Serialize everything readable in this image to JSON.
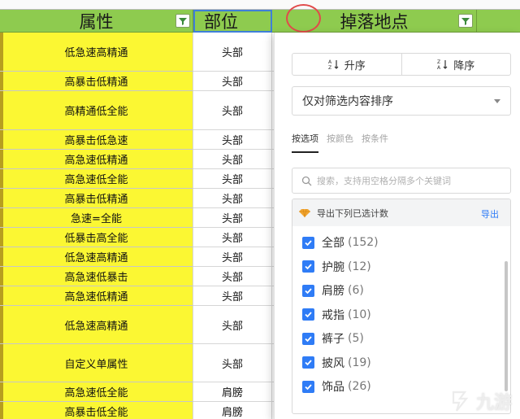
{
  "sheet": {
    "headers": {
      "attribute": "属性",
      "position": "部位",
      "drop_location": "掉落地点"
    },
    "rows": [
      {
        "attribute": "低急速高精通",
        "position": "头部"
      },
      {
        "attribute": "高暴击低精通",
        "position": "头部"
      },
      {
        "attribute": "高精通低全能",
        "position": "头部"
      },
      {
        "attribute": "高暴击低急速",
        "position": "头部"
      },
      {
        "attribute": "高急速低精通",
        "position": "头部"
      },
      {
        "attribute": "高急速低全能",
        "position": "头部"
      },
      {
        "attribute": "高暴击低精通",
        "position": "头部"
      },
      {
        "attribute": "急速=全能",
        "position": "头部"
      },
      {
        "attribute": "低暴击高全能",
        "position": "头部"
      },
      {
        "attribute": "低急速高精通",
        "position": "头部"
      },
      {
        "attribute": "高急速低暴击",
        "position": "头部"
      },
      {
        "attribute": "高急速低精通",
        "position": "头部"
      },
      {
        "attribute": "低急速高精通",
        "position": "头部"
      },
      {
        "attribute": "自定义单属性",
        "position": "头部"
      },
      {
        "attribute": "高急速低全能",
        "position": "肩膀"
      },
      {
        "attribute": "高暴击低全能",
        "position": "肩膀"
      }
    ]
  },
  "filter_panel": {
    "sort_asc": "升序",
    "sort_desc": "降序",
    "sort_scope": "仅对筛选内容排序",
    "tabs": [
      "按选项",
      "按颜色",
      "按条件"
    ],
    "search_placeholder": "搜索，支持用空格分隔多个关键词",
    "export_label": "导出下列已选计数",
    "export_link": "导出",
    "options": [
      {
        "label": "全部",
        "count": "(152)",
        "checked": true
      },
      {
        "label": "护腕",
        "count": "(12)",
        "checked": true
      },
      {
        "label": "肩膀",
        "count": "(6)",
        "checked": true
      },
      {
        "label": "戒指",
        "count": "(10)",
        "checked": true
      },
      {
        "label": "裤子",
        "count": "(5)",
        "checked": true
      },
      {
        "label": "披风",
        "count": "(19)",
        "checked": true
      },
      {
        "label": "饰品",
        "count": "(26)",
        "checked": true
      }
    ]
  },
  "colors": {
    "header_green": "#8ecb4f",
    "attribute_yellow": "#fbf733",
    "accent_blue": "#2f7cf6",
    "highlight_red": "#e14b4b"
  },
  "watermark": {
    "text": "九游"
  }
}
